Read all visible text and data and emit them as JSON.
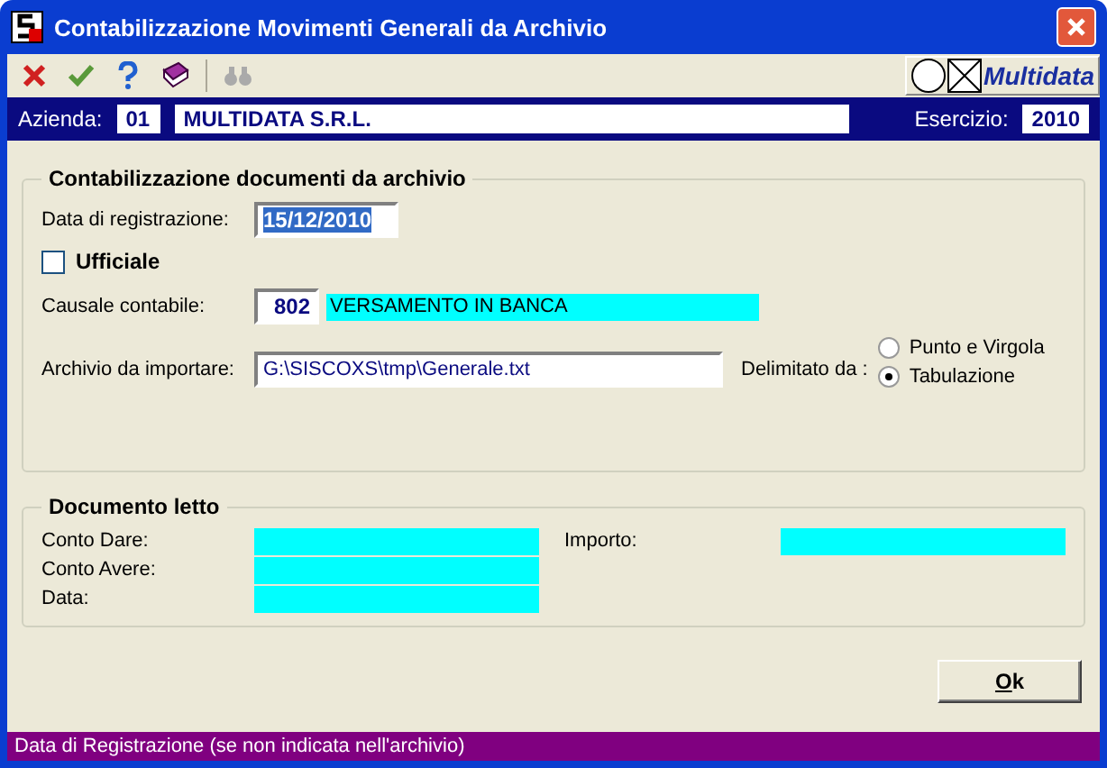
{
  "window": {
    "title": "Contabilizzazione Movimenti Generali da Archivio"
  },
  "toolbar": {
    "brand": "Multidata"
  },
  "company_bar": {
    "azienda_label": "Azienda:",
    "azienda_code": "01",
    "azienda_name": "MULTIDATA S.R.L.",
    "esercizio_label": "Esercizio:",
    "esercizio": "2010"
  },
  "import_group": {
    "title": "Contabilizzazione documenti da archivio",
    "date_label": "Data di registrazione:",
    "date_value": "15/12/2010",
    "ufficiale": {
      "label": "Ufficiale",
      "checked": false
    },
    "causale_label": "Causale contabile:",
    "causale_code": "802",
    "causale_desc": "VERSAMENTO IN BANCA",
    "file_label": "Archivio da importare:",
    "file_value": "G:\\SISCOXS\\tmp\\Generale.txt",
    "delim_label": "Delimitato da :",
    "delimiters": [
      {
        "label": "Punto e Virgola",
        "selected": false
      },
      {
        "label": "Tabulazione",
        "selected": true
      }
    ]
  },
  "read_group": {
    "title": "Documento letto",
    "left": [
      "Conto Dare:",
      "Conto Avere:",
      "Data:"
    ],
    "right": [
      "Importo:"
    ]
  },
  "ok_button": "Ok",
  "status_bar": "Data di Registrazione (se non indicata nell'archivio)"
}
